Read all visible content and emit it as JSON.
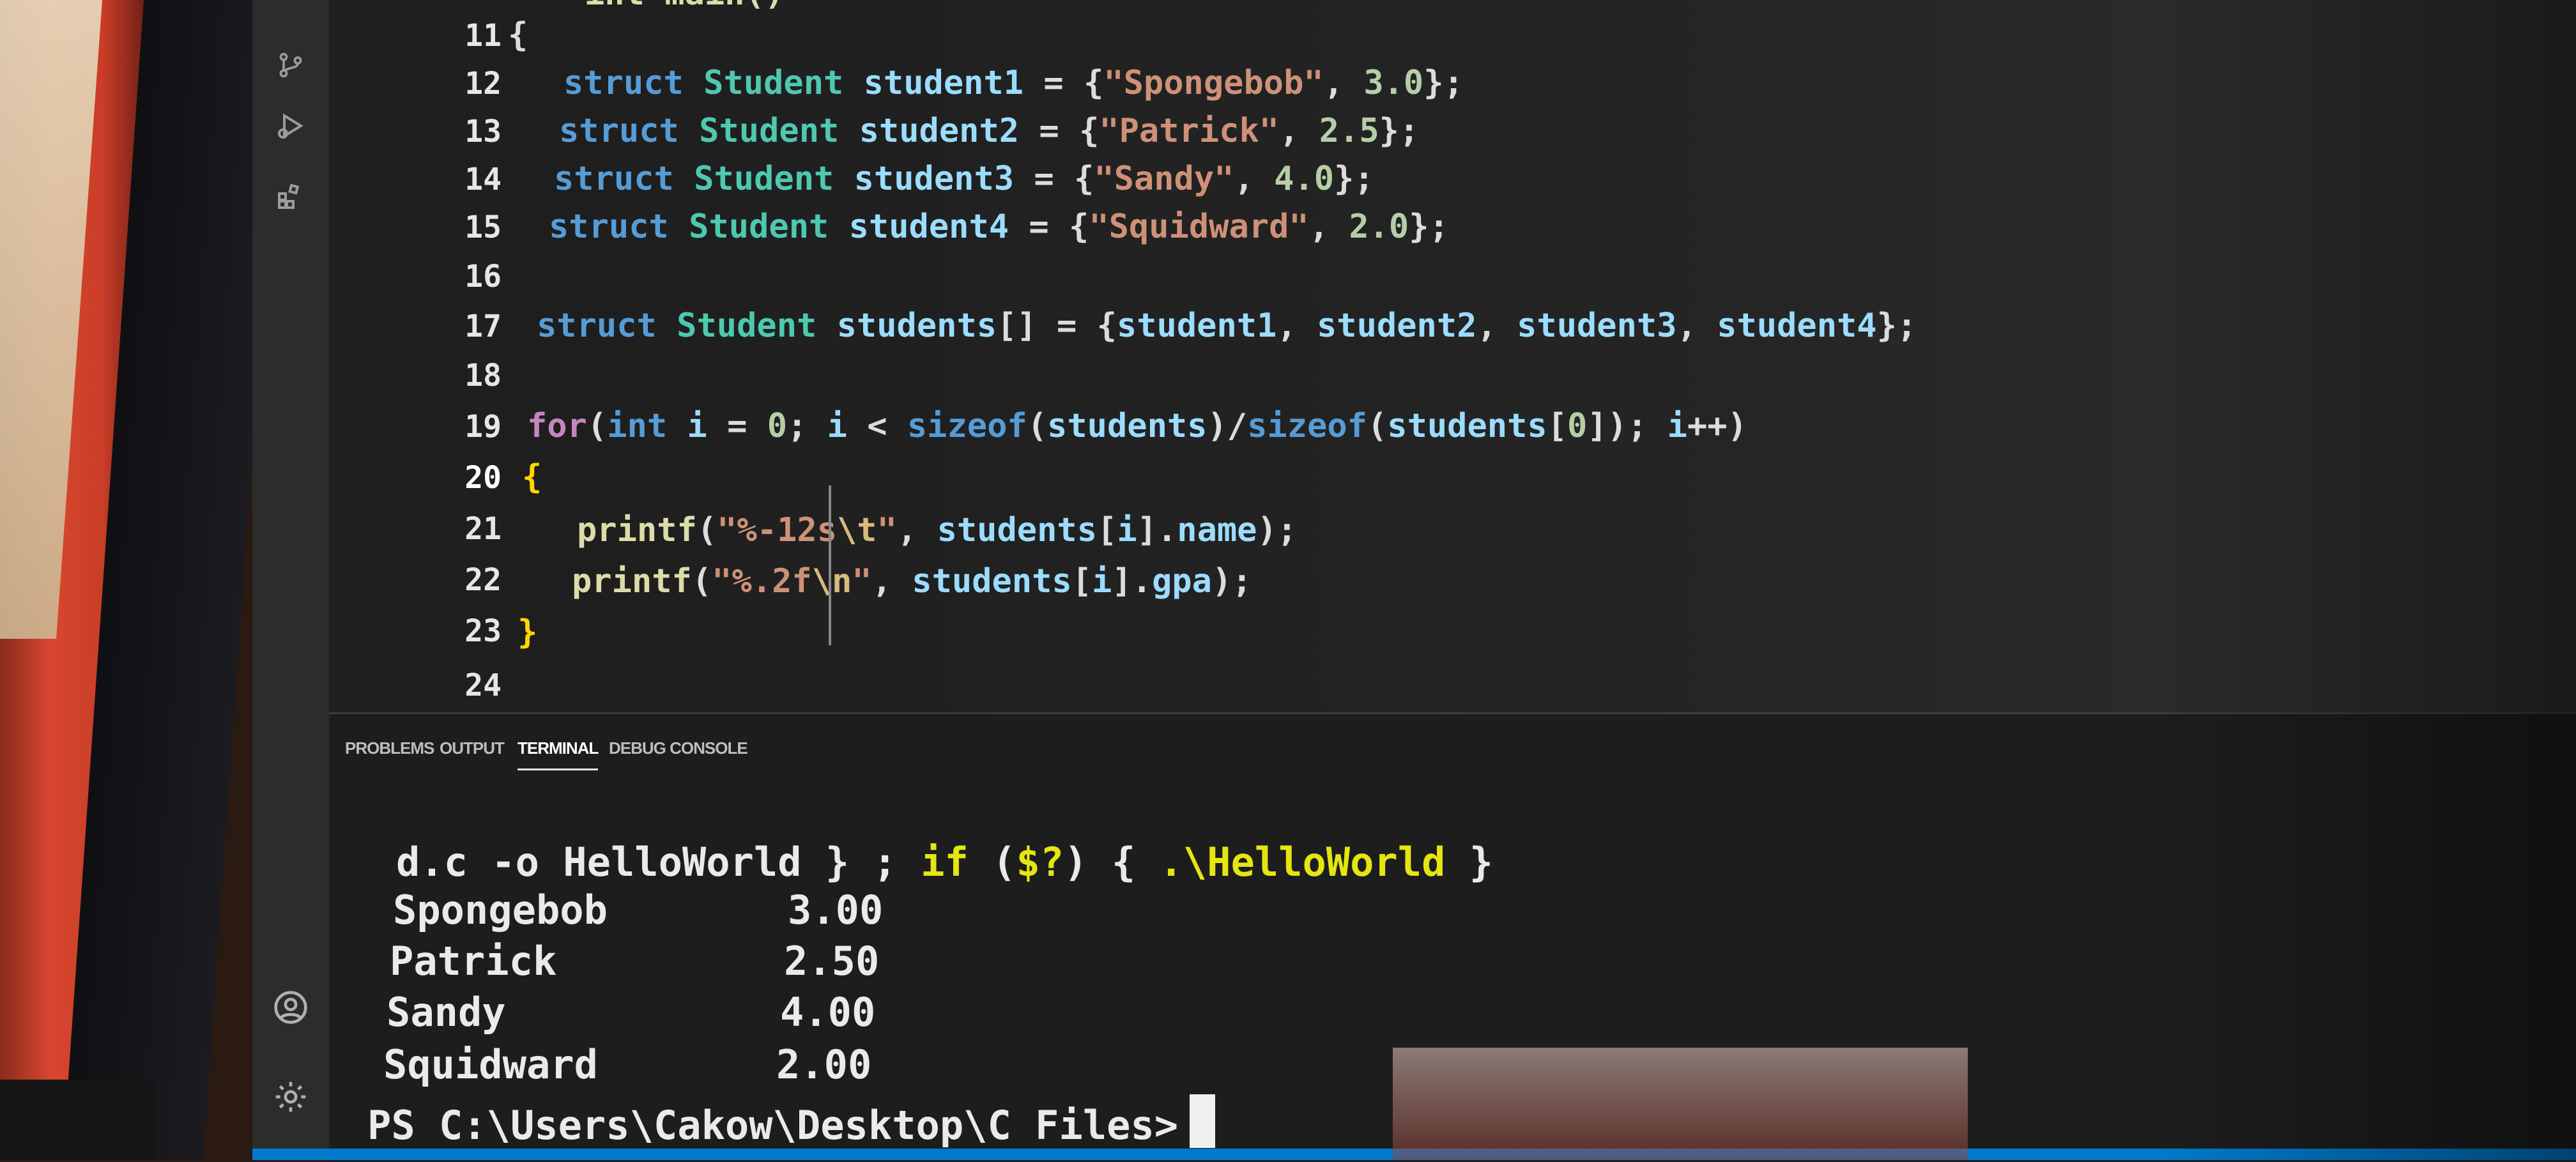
{
  "editor": {
    "partial_line_top": "int main()",
    "lines": [
      {
        "n": "11",
        "text": "{"
      },
      {
        "n": "12",
        "text": "struct Student student1 = {\"Spongebob\", 3.0};"
      },
      {
        "n": "13",
        "text": "struct Student student2 = {\"Patrick\", 2.5};"
      },
      {
        "n": "14",
        "text": "struct Student student3 = {\"Sandy\", 4.0};"
      },
      {
        "n": "15",
        "text": "struct Student student4 = {\"Squidward\", 2.0};"
      },
      {
        "n": "16",
        "text": ""
      },
      {
        "n": "17",
        "text": "struct Student students[] = {student1, student2, student3, student4};"
      },
      {
        "n": "18",
        "text": ""
      },
      {
        "n": "19",
        "text": "for(int i = 0; i < sizeof(students)/sizeof(students[0]); i++)"
      },
      {
        "n": "20",
        "text": "{"
      },
      {
        "n": "21",
        "text": "printf(\"%-12s\\t\", students[i].name);"
      },
      {
        "n": "22",
        "text": "printf(\"%.2f\\n\", students[i].gpa);"
      },
      {
        "n": "23",
        "text": "}"
      },
      {
        "n": "24",
        "text": ""
      }
    ]
  },
  "panel": {
    "tabs": [
      "PROBLEMS",
      "OUTPUT",
      "TERMINAL",
      "DEBUG CONSOLE"
    ],
    "active_tab": "TERMINAL"
  },
  "terminal": {
    "command": "d.c -o HelloWorld } ; if ($?) { .\\HelloWorld }",
    "output": [
      {
        "name": "Spongebob",
        "gpa": "3.00"
      },
      {
        "name": "Patrick",
        "gpa": "2.50"
      },
      {
        "name": "Sandy",
        "gpa": "4.00"
      },
      {
        "name": "Squidward",
        "gpa": "2.00"
      }
    ],
    "prompt": "PS C:\\Users\\Cakow\\Desktop\\C Files>"
  },
  "icons": {
    "activity_bar": [
      "source-control-icon",
      "run-debug-icon",
      "extensions-icon",
      "account-icon",
      "settings-gear-icon"
    ]
  },
  "colors": {
    "keyword": "#569cd6",
    "type": "#4ec9b0",
    "string": "#ce9178",
    "number": "#b5cea8",
    "function": "#dcdcaa",
    "statusbar": "#007acc"
  }
}
